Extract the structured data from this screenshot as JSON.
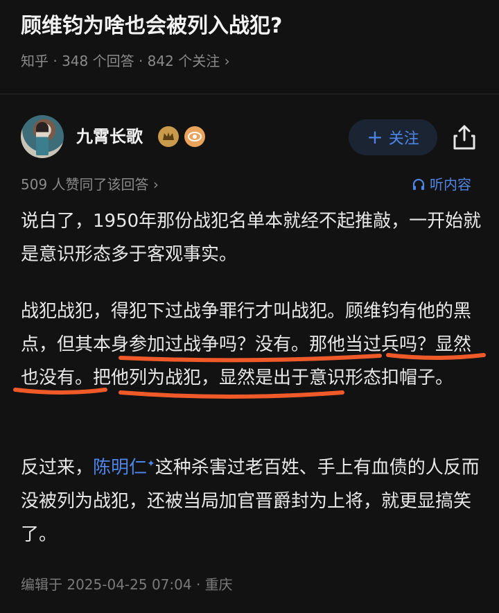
{
  "question": {
    "title": "顾维钧为啥也会被列入战犯?",
    "meta": "知乎 · 348 个回答 · 842 个关注 ›"
  },
  "author": {
    "name": "九霄长歌",
    "follow_label": "关注"
  },
  "answer": {
    "likes_text": "509 人赞同了该回答 ›",
    "listen_label": "听内容",
    "para1": "说白了，1950年那份战犯名单本就经不起推敲，一开始就是意识形态多于客观事实。",
    "para2": "战犯战犯，得犯下过战争罪行才叫战犯。顾维钧有他的黑点，但其本身参加过战争吗？没有。那他当过兵吗？显然也没有。把他列为战犯，显然是出于意识形态扣帽子。",
    "para3_before": "反过来，",
    "para3_link": "陈明仁",
    "para3_after": "这种杀害过老百姓、手上有血债的人反而没被列为战犯，还被当局加官晋爵封为上将，就更显搞笑了。",
    "footer": "编辑于 2025-04-25 07:04 · 重庆"
  },
  "colors": {
    "background": "#121212",
    "accent": "#4e86e8",
    "annotation": "#f05a28"
  },
  "icons": [
    "avatar",
    "level-badge-icon",
    "eye-badge-icon",
    "plus-icon",
    "share-icon",
    "headphones-icon",
    "sparkle-icon"
  ]
}
